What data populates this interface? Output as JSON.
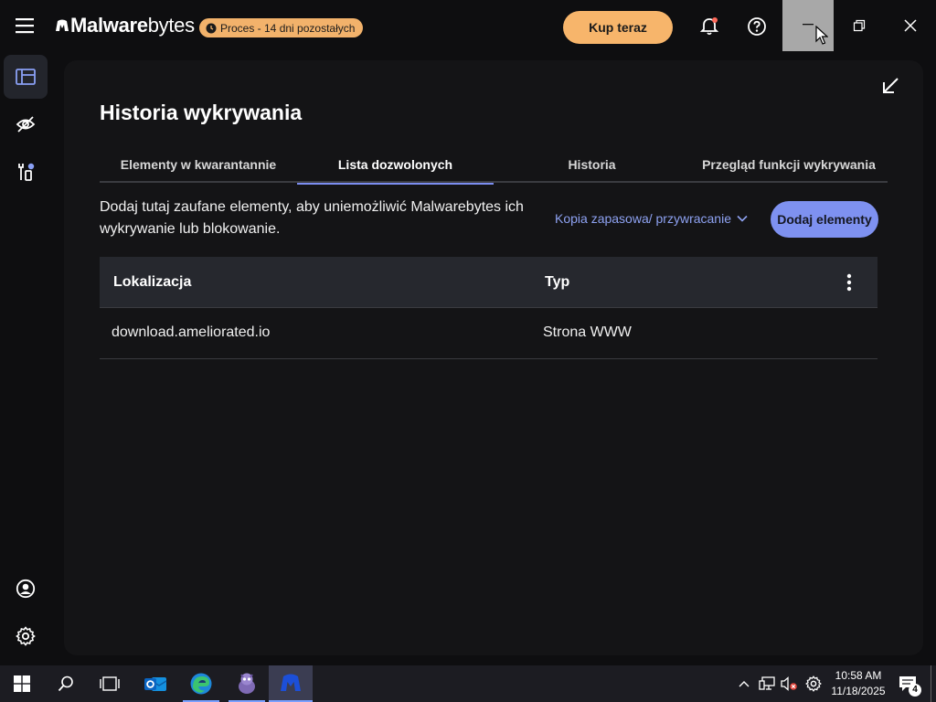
{
  "app": {
    "logo_bold": "Malware",
    "logo_light": "bytes",
    "trial_badge": "Proces - 14 dni pozostałych",
    "buy_button": "Kup teraz"
  },
  "page": {
    "title": "Historia wykrywania",
    "tabs": [
      {
        "label": "Elementy w kwarantannie",
        "active": false
      },
      {
        "label": "Lista dozwolonych",
        "active": true
      },
      {
        "label": "Historia",
        "active": false
      },
      {
        "label": "Przegląd funkcji wykrywania",
        "active": false
      }
    ],
    "description": "Dodaj tutaj zaufane elementy, aby uniemożliwić Malwarebytes ich wykrywanie lub blokowanie.",
    "backup_link": "Kopia zapasowa/ przywracanie",
    "add_button": "Dodaj elementy"
  },
  "table": {
    "headers": [
      "Lokalizacja",
      "Typ"
    ],
    "rows": [
      {
        "location": "download.ameliorated.io",
        "type": "Strona WWW"
      }
    ]
  },
  "taskbar": {
    "time": "10:58 AM",
    "date": "11/18/2025",
    "notifications": "4"
  },
  "colors": {
    "accent": "#7e91f0",
    "buy": "#f7b56b",
    "background": "#0e0e10",
    "panel": "#141416"
  }
}
